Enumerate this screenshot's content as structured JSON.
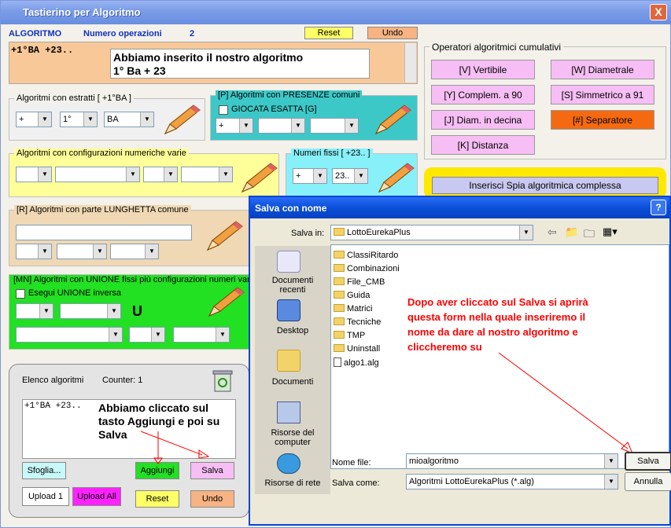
{
  "main": {
    "title": "Tastierino per Algoritmo",
    "close": "X",
    "header": {
      "algoritmo": "ALGORITMO",
      "numero_operazioni_label": "Numero operazioni",
      "numero_operazioni": "2",
      "reset": "Reset",
      "undo": "Undo"
    },
    "formula": "+1°BA +23..",
    "note_line1": "Abbiamo inserito il nostro algoritmo",
    "note_line2": "1° Ba + 23",
    "group_estratti": {
      "title": "Algoritmi con estratti  [ +1°BA ]",
      "sel1": "+",
      "sel2": "1°",
      "sel3": "BA"
    },
    "group_presenze": {
      "title": "[P] Algoritmi con PRESENZE comuni",
      "check": "GIOCATA ESATTA  [G]",
      "sel1": "+"
    },
    "group_config": {
      "title": "Algoritmi con configurazioni numeriche varie"
    },
    "group_fissi": {
      "title": "Numeri fissi  [ +23.. ]",
      "sel1": "+",
      "sel2": "23.."
    },
    "group_lunghetta": {
      "title": "[R] Algoritmi con parte LUNGHETTA comune"
    },
    "group_unione": {
      "title": "[MN] Algoritmi con UNIONE fissi più configurazioni numeri vari",
      "check": "Esegui UNIONE inversa",
      "u": "U"
    },
    "operatori": {
      "title": "Operatori algoritmici cumulativi",
      "v": "[V] Vertibile",
      "w": "[W] Diametrale",
      "y": "[Y] Complem. a 90",
      "s": "[S] Simmetrico  a 91",
      "j": "[J] Diam. in decina",
      "sep": "[#] Separatore",
      "k": "[K] Distanza"
    },
    "spia": "Inserisci Spia algoritmica complessa",
    "elenco": {
      "title": "Elenco algoritmi",
      "counter": "Counter: 1",
      "item": "+1°BA +23..",
      "note_line1": "Abbiamo cliccato sul",
      "note_line2": "tasto Aggiungi e poi su",
      "note_line3": "Salva",
      "sfoglia": "Sfoglia...",
      "aggiungi": "Aggiungi",
      "salva": "Salva",
      "upload1": "Upload 1",
      "upload_all": "Upload All",
      "reset": "Reset",
      "undo": "Undo"
    }
  },
  "dialog": {
    "title": "Salva con nome",
    "help": "?",
    "salva_in_label": "Salva in:",
    "salva_in_value": "LottoEurekaPlus",
    "places": [
      "Documenti recenti",
      "Desktop",
      "Documenti",
      "Risorse del computer",
      "Risorse di rete"
    ],
    "items": [
      "ClassiRitardo",
      "Combinazioni",
      "File_CMB",
      "Guida",
      "Matrici",
      "Tecniche",
      "TMP",
      "Uninstall",
      "algo1.alg"
    ],
    "note_line1": "Dopo aver cliccato sul Salva si aprirà",
    "note_line2": "questa form nella quale inseriremo il",
    "note_line3": "nome da dare al nostro algoritmo e",
    "note_line4": "cliccheremo su",
    "nome_file_label": "Nome file:",
    "nome_file_value": "mioalgoritmo",
    "salva_come_label": "Salva come:",
    "salva_come_value": "Algoritmi LottoEurekaPlus (*.alg)",
    "salva_button": "Salva",
    "annulla_button": "Annulla"
  }
}
